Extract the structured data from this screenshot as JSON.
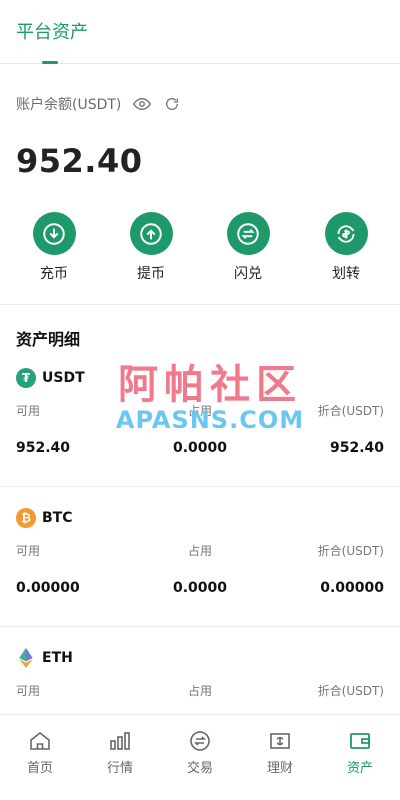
{
  "header": {
    "tab_title": "平台资产"
  },
  "balance": {
    "label": "账户余额(USDT)",
    "value": "952.40"
  },
  "actions": [
    {
      "label": "充币",
      "icon": "deposit-icon"
    },
    {
      "label": "提币",
      "icon": "withdraw-icon"
    },
    {
      "label": "闪兑",
      "icon": "swap-icon"
    },
    {
      "label": "划转",
      "icon": "transfer-icon"
    }
  ],
  "section_title": "资产明细",
  "assets": [
    {
      "name": "USDT",
      "labels": [
        "可用",
        "占用",
        "折合(USDT)"
      ],
      "available": "952.40",
      "occupied": "0.0000",
      "converted": "952.40",
      "color": "#26a17b"
    },
    {
      "name": "BTC",
      "labels": [
        "可用",
        "占用",
        "折合(USDT)"
      ],
      "available": "0.00000",
      "occupied": "0.0000",
      "converted": "0.00000",
      "color": "#f29a2e"
    },
    {
      "name": "ETH",
      "labels": [
        "可用",
        "占用",
        "折合(USDT)"
      ],
      "available": "",
      "occupied": "",
      "converted": "",
      "color": "#6b7bd6"
    }
  ],
  "watermark": {
    "line1": "阿帕社区",
    "line2": "APASNS.COM"
  },
  "nav": [
    {
      "label": "首页",
      "icon": "home-icon"
    },
    {
      "label": "行情",
      "icon": "market-icon"
    },
    {
      "label": "交易",
      "icon": "trade-icon"
    },
    {
      "label": "理财",
      "icon": "finance-icon"
    },
    {
      "label": "资产",
      "icon": "wallet-icon",
      "active": true
    }
  ],
  "colors": {
    "accent": "#1e9a6a"
  }
}
